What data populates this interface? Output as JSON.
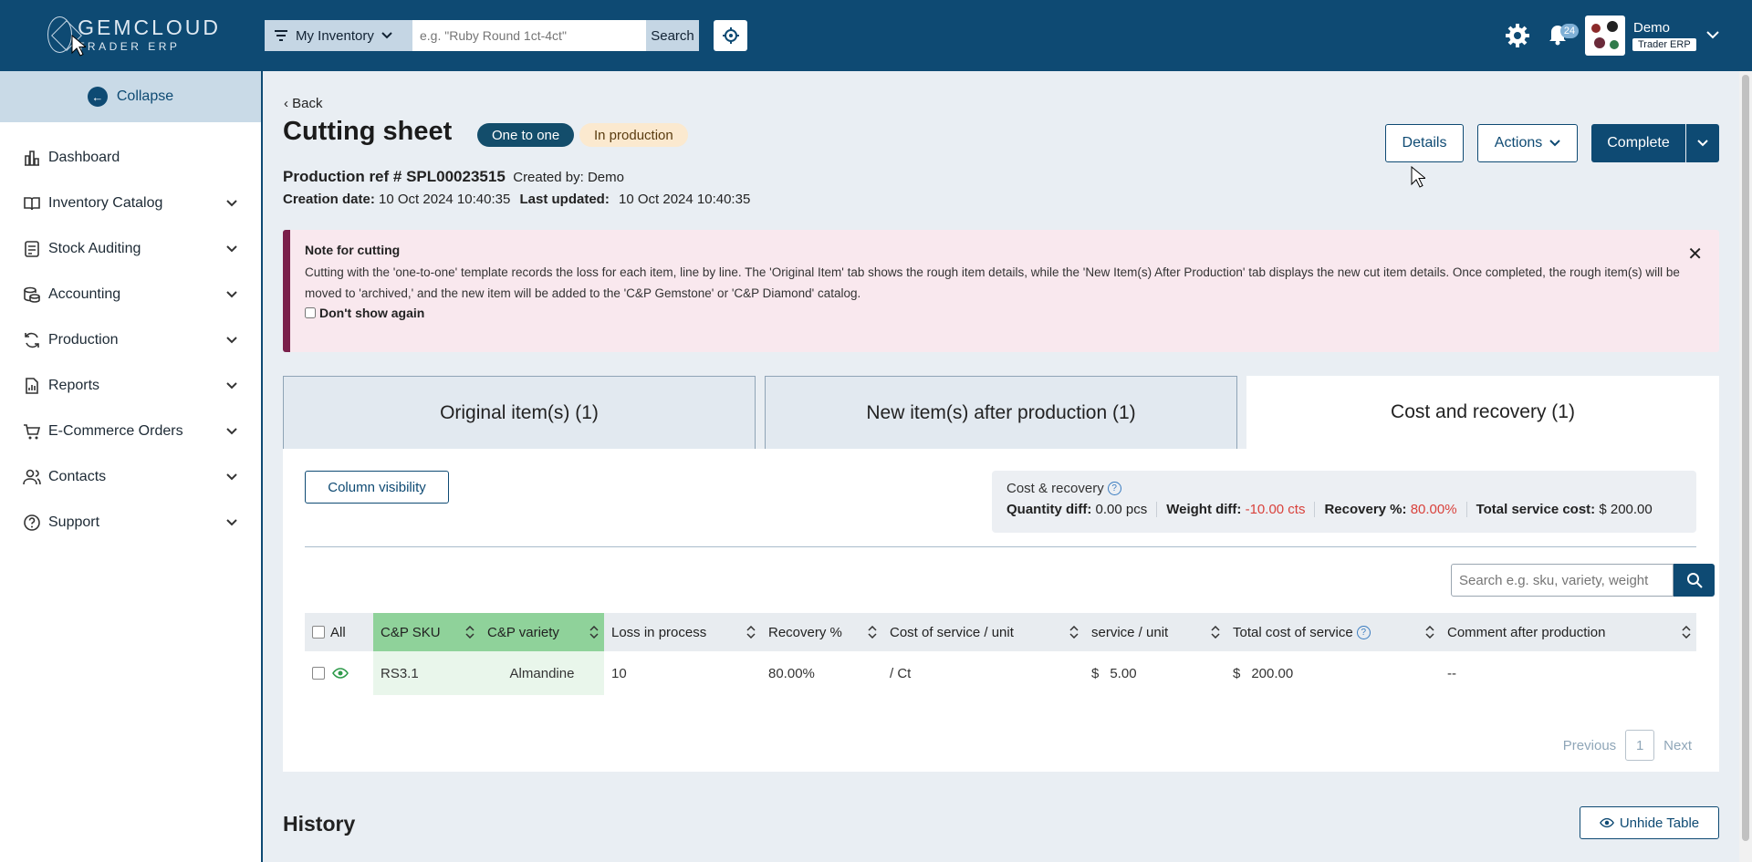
{
  "header": {
    "logo_line1": "GEMCLOUD",
    "logo_line2": "TRADER ERP",
    "inventory_select": "My Inventory",
    "search_placeholder": "e.g. \"Ruby Round 1ct-4ct\"",
    "search_button": "Search",
    "notification_count": "24",
    "user_name": "Demo",
    "user_role": "Trader ERP"
  },
  "sidebar": {
    "collapse_label": "Collapse",
    "items": [
      {
        "label": "Dashboard",
        "icon": "chart-icon",
        "expandable": false
      },
      {
        "label": "Inventory Catalog",
        "icon": "book-icon",
        "expandable": true
      },
      {
        "label": "Stock Auditing",
        "icon": "clipboard-icon",
        "expandable": true
      },
      {
        "label": "Accounting",
        "icon": "coins-icon",
        "expandable": true
      },
      {
        "label": "Production",
        "icon": "refresh-icon",
        "expandable": true
      },
      {
        "label": "Reports",
        "icon": "report-icon",
        "expandable": true
      },
      {
        "label": "E-Commerce Orders",
        "icon": "cart-icon",
        "expandable": true
      },
      {
        "label": "Contacts",
        "icon": "users-icon",
        "expandable": true
      },
      {
        "label": "Support",
        "icon": "help-icon",
        "expandable": true
      }
    ]
  },
  "page": {
    "back_label": "Back",
    "title": "Cutting sheet",
    "badge_type": "One to one",
    "badge_status": "In production",
    "production_ref_label": "Production ref # SPL00023515",
    "created_by": "Created by: Demo",
    "creation_date_label": "Creation date:",
    "creation_date": "10 Oct 2024 10:40:35",
    "last_updated_label": "Last updated:",
    "last_updated": "10 Oct 2024 10:40:35",
    "details_button": "Details",
    "actions_button": "Actions",
    "complete_button": "Complete"
  },
  "note": {
    "title": "Note for cutting",
    "body": "Cutting with the 'one-to-one' template records the loss for each item, line by line. The 'Original Item' tab shows the rough item details, while the 'New Item(s) After Production' tab displays the new cut item details. Once completed, the rough item(s) will be moved to 'archived,' and the new item will be added to the 'C&P Gemstone' or 'C&P Diamond' catalog.",
    "dont_show": "Don't show again"
  },
  "tabs": [
    {
      "label": "Original item(s) (1)",
      "active": false
    },
    {
      "label": "New item(s) after production (1)",
      "active": false
    },
    {
      "label": "Cost and recovery (1)",
      "active": true
    }
  ],
  "panel": {
    "column_visibility": "Column visibility",
    "cost_recovery_title": "Cost & recovery",
    "quantity_diff_label": "Quantity diff:",
    "quantity_diff": "0.00 pcs",
    "weight_diff_label": "Weight diff:",
    "weight_diff": "-10.00 cts",
    "recovery_label": "Recovery %:",
    "recovery": "80.00%",
    "service_cost_label": "Total service cost:",
    "service_cost": "$ 200.00",
    "table_search_placeholder": "Search e.g. sku, variety, weight"
  },
  "table": {
    "headers": [
      "All",
      "C&P SKU",
      "C&P variety",
      "Loss in process",
      "Recovery %",
      "Cost of service / unit",
      "service / unit",
      "Total cost of service",
      "Comment after production"
    ],
    "rows": [
      {
        "sku": "RS3.1",
        "variety": "Almandine",
        "loss": "10",
        "recovery": "80.00%",
        "cost_unit": "/ Ct",
        "service_currency": "$",
        "service_unit": "5.00",
        "total_currency": "$",
        "total": "200.00",
        "comment": "--"
      }
    ],
    "previous": "Previous",
    "page": "1",
    "next": "Next"
  },
  "history": {
    "title": "History",
    "unhide_button": "Unhide Table"
  },
  "colors": {
    "brand": "#0e4a73",
    "note_accent": "#7a1f4a",
    "green_col": "#8fd29a",
    "negative": "#d9423c"
  }
}
